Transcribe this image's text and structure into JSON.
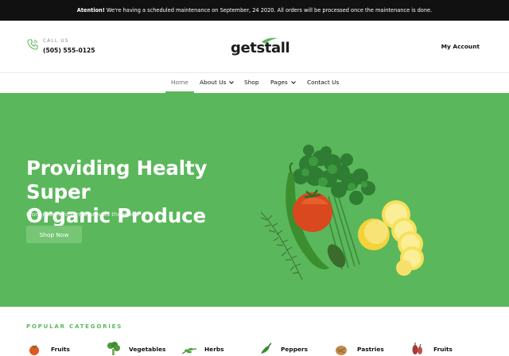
{
  "announcement": {
    "label": "Atention!",
    "message": "We're having a scheduled maintenance on September, 24 2020. All orders will be processed once the maintenance is done."
  },
  "header": {
    "call_label": "CALL US",
    "call_number": "(505) 555-0125",
    "logo_text": "getstall",
    "account_label": "My Account"
  },
  "nav": {
    "items": [
      {
        "label": "Home",
        "active": true
      },
      {
        "label": "About Us",
        "dropdown": true
      },
      {
        "label": "Shop"
      },
      {
        "label": "Pages",
        "dropdown": true
      },
      {
        "label": "Contact Us"
      }
    ]
  },
  "hero": {
    "title_line1": "Providing Healty Super",
    "title_line2": "Organic Produce",
    "subtitle": "From reserved farms around the world",
    "button_label": "Shop Now"
  },
  "categories": {
    "heading": "POPULAR CATEGORIES",
    "items": [
      {
        "label": "Fruits",
        "icon": "tomato-icon"
      },
      {
        "label": "Vegetables",
        "icon": "broccoli-icon"
      },
      {
        "label": "Herbs",
        "icon": "herb-icon"
      },
      {
        "label": "Peppers",
        "icon": "pepper-icon"
      },
      {
        "label": "Pastries",
        "icon": "pastry-icon"
      },
      {
        "label": "Fruits",
        "icon": "berries-icon"
      }
    ]
  },
  "colors": {
    "accent": "#5cb85c",
    "hero_bg": "#5bb75b",
    "topbar_bg": "#111111"
  }
}
